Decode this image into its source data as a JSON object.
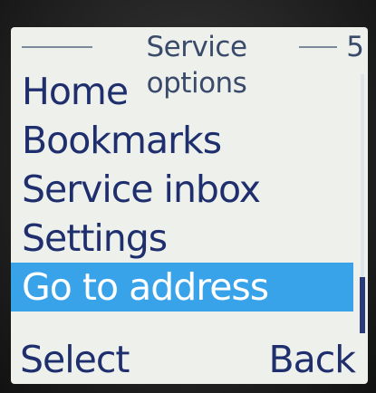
{
  "header": {
    "title": "Service options",
    "page_number": "5"
  },
  "menu": {
    "items": [
      {
        "label": "Home"
      },
      {
        "label": "Bookmarks"
      },
      {
        "label": "Service inbox"
      },
      {
        "label": "Settings"
      },
      {
        "label": "Go to address"
      }
    ],
    "selected_index": 4
  },
  "softkeys": {
    "left": "Select",
    "right": "Back"
  },
  "colors": {
    "screen_background": "#eef0ec",
    "text": "#1f2f6e",
    "highlight": "#39a3ea",
    "highlight_text": "#ffffff"
  }
}
